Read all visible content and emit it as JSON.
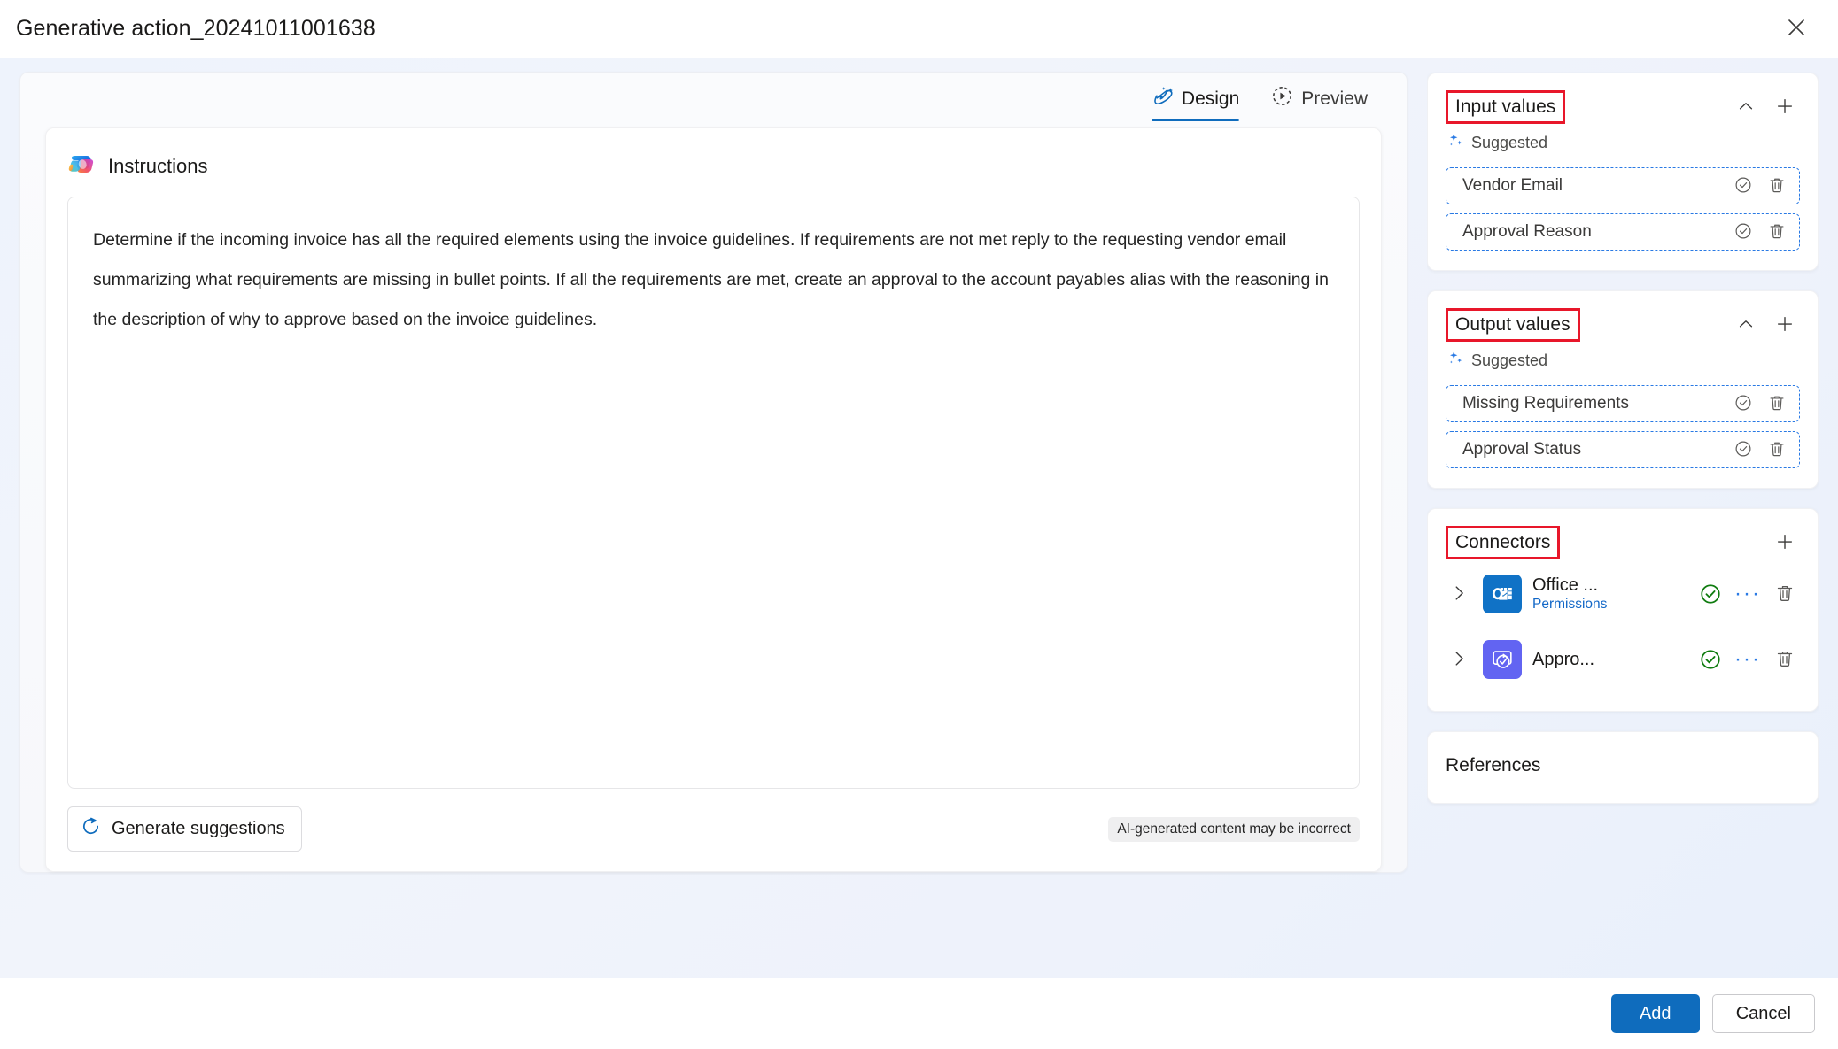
{
  "header": {
    "title": "Generative action_20241011001638",
    "close_icon": "close-icon"
  },
  "tabs": [
    {
      "label": "Design",
      "icon": "magic-wand-sparkle-icon",
      "active": true
    },
    {
      "label": "Preview",
      "icon": "play-circle-dashed-icon",
      "active": false
    }
  ],
  "instructions": {
    "icon": "copilot-icon",
    "title": "Instructions",
    "text": "Determine if the incoming invoice has all the required elements using the invoice guidelines. If requirements are not met reply to the requesting vendor email summarizing what requirements are missing in bullet points. If all the requirements are met, create an approval to the account payables alias with the reasoning in the description of why to approve based on the invoice guidelines.",
    "generate_button": "Generate suggestions",
    "generate_icon": "refresh-icon",
    "ai_note": "AI-generated content may be incorrect"
  },
  "input_values": {
    "title": "Input values",
    "collapse_icon": "chevron-up-icon",
    "add_icon": "plus-icon",
    "suggested_label": "Suggested",
    "suggested_icon": "sparkle-icon",
    "items": [
      {
        "name": "Vendor Email",
        "accept_icon": "check-circle-icon",
        "delete_icon": "trash-icon"
      },
      {
        "name": "Approval Reason",
        "accept_icon": "check-circle-icon",
        "delete_icon": "trash-icon"
      }
    ]
  },
  "output_values": {
    "title": "Output values",
    "collapse_icon": "chevron-up-icon",
    "add_icon": "plus-icon",
    "suggested_label": "Suggested",
    "suggested_icon": "sparkle-icon",
    "items": [
      {
        "name": "Missing Requirements",
        "accept_icon": "check-circle-icon",
        "delete_icon": "trash-icon"
      },
      {
        "name": "Approval Status",
        "accept_icon": "check-circle-icon",
        "delete_icon": "trash-icon"
      }
    ]
  },
  "connectors": {
    "title": "Connectors",
    "add_icon": "plus-icon",
    "items": [
      {
        "name": "Office ...",
        "sublabel": "Permissions",
        "logo": "office365-outlook-icon",
        "status_icon": "check-circle-green-icon",
        "more_icon": "ellipsis-icon",
        "delete_icon": "trash-icon",
        "expand_icon": "chevron-right-icon"
      },
      {
        "name": "Appro...",
        "sublabel": "",
        "logo": "approvals-icon",
        "status_icon": "check-circle-green-icon",
        "more_icon": "ellipsis-icon",
        "delete_icon": "trash-icon",
        "expand_icon": "chevron-right-icon"
      }
    ]
  },
  "references": {
    "title": "References"
  },
  "footer": {
    "primary_label": "Add",
    "secondary_label": "Cancel"
  },
  "colors": {
    "accent_blue": "#0f6cbd",
    "highlight_red": "#e8172a",
    "dashed_border_blue": "#2a7ae4",
    "status_green": "#107c10",
    "outlook_blue": "#1072c6",
    "approvals_purple": "#6264f2",
    "link_blue": "#1267c7"
  }
}
